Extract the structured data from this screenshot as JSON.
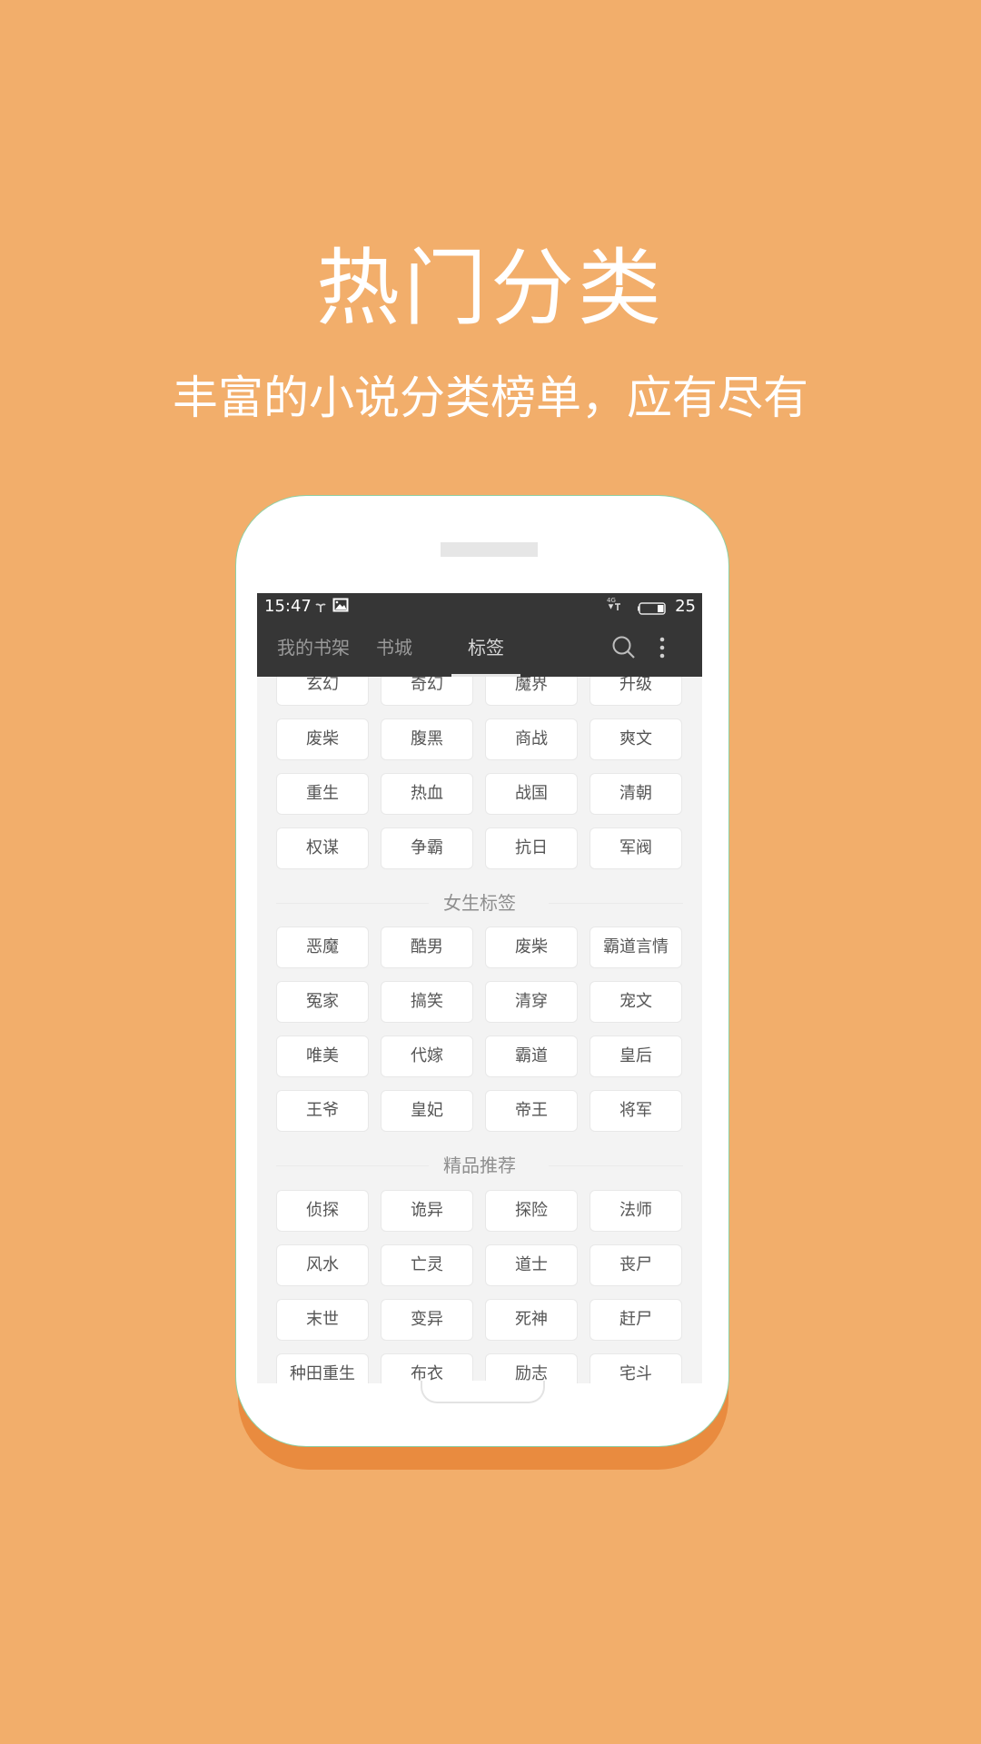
{
  "hero": {
    "title": "热门分类",
    "subtitle": "丰富的小说分类榜单，应有尽有"
  },
  "colors": {
    "background": "#F2AE6B",
    "phone_shadow": "#E98B3F",
    "toolbar": "#363636",
    "screen_bg": "#F3F3F3"
  },
  "status_bar": {
    "time": "15:47",
    "icons_left": [
      "signal-sprout-icon",
      "image-icon"
    ],
    "network": "4G",
    "battery_level": "25"
  },
  "toolbar": {
    "tabs": [
      {
        "label": "我的书架",
        "active": false
      },
      {
        "label": "书城",
        "active": false
      },
      {
        "label": "标签",
        "active": true
      }
    ],
    "search_icon": "search-icon",
    "menu_icon": "more-vertical-icon"
  },
  "sections": [
    {
      "title": "",
      "tags": [
        "玄幻",
        "奇幻",
        "魔界",
        "升级",
        "废柴",
        "腹黑",
        "商战",
        "爽文",
        "重生",
        "热血",
        "战国",
        "清朝",
        "权谋",
        "争霸",
        "抗日",
        "军阀"
      ]
    },
    {
      "title": "女生标签",
      "tags": [
        "恶魔",
        "酷男",
        "废柴",
        "霸道言情",
        "冤家",
        "搞笑",
        "清穿",
        "宠文",
        "唯美",
        "代嫁",
        "霸道",
        "皇后",
        "王爷",
        "皇妃",
        "帝王",
        "将军"
      ]
    },
    {
      "title": "精品推荐",
      "tags": [
        "侦探",
        "诡异",
        "探险",
        "法师",
        "风水",
        "亡灵",
        "道士",
        "丧尸",
        "末世",
        "变异",
        "死神",
        "赶尸",
        "种田重生",
        "布衣",
        "励志",
        "宅斗"
      ]
    }
  ]
}
